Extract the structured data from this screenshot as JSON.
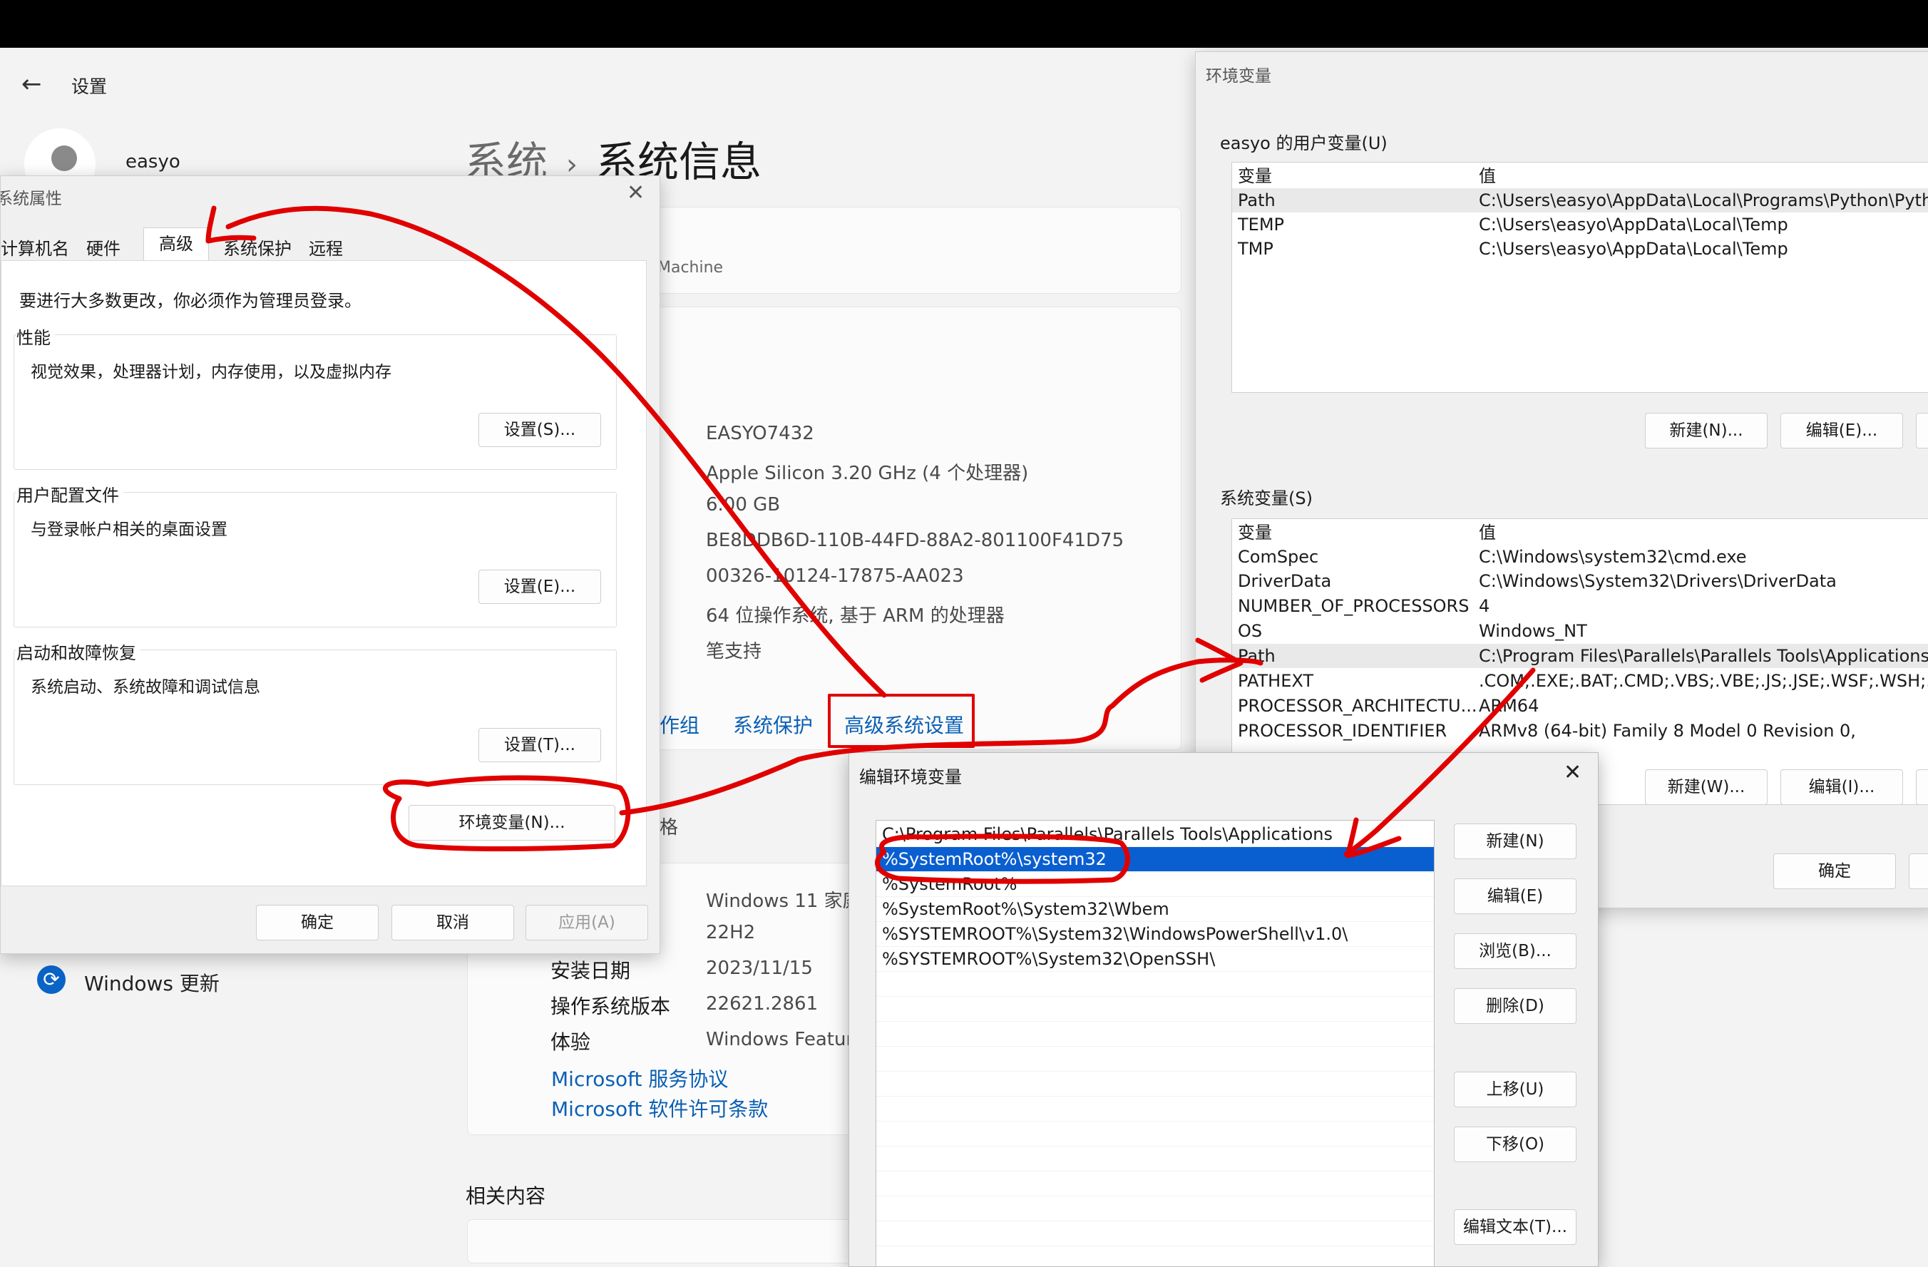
{
  "settings": {
    "app_title": "设置",
    "username": "easyo",
    "breadcrumb_parent": "系统",
    "breadcrumb_sep": "›",
    "page_title": "系统信息",
    "device_subtitle": "Machine",
    "specs": [
      "EASYO7432",
      "Apple Silicon    3.20 GHz  (4 个处理器)",
      "6.00 GB",
      "BE8DDB6D-110B-44FD-88A2-801100F41D75",
      "00326-10124-17875-AA023",
      "64 位操作系统, 基于 ARM 的处理器",
      "笔支持"
    ],
    "links": {
      "workgroup": "作组",
      "protection": "系统保护",
      "advanced": "高级系统设置"
    },
    "related_label": "格",
    "win_specs": [
      {
        "label": "",
        "value": "Windows 11 家庭"
      },
      {
        "label": "",
        "value": "22H2"
      },
      {
        "label": "安装日期",
        "value": "2023/11/15"
      },
      {
        "label": "操作系统版本",
        "value": "22621.2861"
      },
      {
        "label": "体验",
        "value": "Windows Featur"
      }
    ],
    "ms_links": [
      "Microsoft 服务协议",
      "Microsoft 软件许可条款"
    ],
    "related_content": "相关内容",
    "windows_update": "Windows 更新"
  },
  "sysprop": {
    "title": "系统属性",
    "tabs": [
      "计算机名",
      "硬件",
      "高级",
      "系统保护",
      "远程"
    ],
    "admin_note": "要进行大多数更改，你必须作为管理员登录。",
    "groups": [
      {
        "title": "性能",
        "desc": "视觉效果，处理器计划，内存使用，以及虚拟内存",
        "button": "设置(S)..."
      },
      {
        "title": "用户配置文件",
        "desc": "与登录帐户相关的桌面设置",
        "button": "设置(E)..."
      },
      {
        "title": "启动和故障恢复",
        "desc": "系统启动、系统故障和调试信息",
        "button": "设置(T)..."
      }
    ],
    "env_button": "环境变量(N)...",
    "ok": "确定",
    "cancel": "取消",
    "apply": "应用(A)"
  },
  "envvars": {
    "title": "环境变量",
    "user_section": "easyo 的用户变量(U)",
    "col_var": "变量",
    "col_val": "值",
    "user_vars": [
      {
        "name": "Path",
        "value": "C:\\Users\\easyo\\AppData\\Local\\Programs\\Python\\Pytho"
      },
      {
        "name": "TEMP",
        "value": "C:\\Users\\easyo\\AppData\\Local\\Temp"
      },
      {
        "name": "TMP",
        "value": "C:\\Users\\easyo\\AppData\\Local\\Temp"
      }
    ],
    "user_new": "新建(N)...",
    "user_edit": "编辑(E)...",
    "sys_section": "系统变量(S)",
    "sys_vars": [
      {
        "name": "ComSpec",
        "value": "C:\\Windows\\system32\\cmd.exe"
      },
      {
        "name": "DriverData",
        "value": "C:\\Windows\\System32\\Drivers\\DriverData"
      },
      {
        "name": "NUMBER_OF_PROCESSORS",
        "value": "4"
      },
      {
        "name": "OS",
        "value": "Windows_NT"
      },
      {
        "name": "Path",
        "value": "C:\\Program Files\\Parallels\\Parallels Tools\\Applications;C"
      },
      {
        "name": "PATHEXT",
        "value": ".COM;.EXE;.BAT;.CMD;.VBS;.VBE;.JS;.JSE;.WSF;.WSH;.MSC"
      },
      {
        "name": "PROCESSOR_ARCHITECTU...",
        "value": "ARM64"
      },
      {
        "name": "PROCESSOR_IDENTIFIER",
        "value": "ARMv8 (64-bit) Family 8 Model 0 Revision   0,"
      }
    ],
    "sys_new": "新建(W)...",
    "sys_edit": "编辑(I)...",
    "ok": "确定"
  },
  "editenv": {
    "title": "编辑环境变量",
    "entries": [
      "C:\\Program Files\\Parallels\\Parallels Tools\\Applications",
      "%SystemRoot%\\system32",
      "%SystemRoot%",
      "%SystemRoot%\\System32\\Wbem",
      "%SYSTEMROOT%\\System32\\WindowsPowerShell\\v1.0\\",
      "%SYSTEMROOT%\\System32\\OpenSSH\\"
    ],
    "buttons": {
      "new": "新建(N)",
      "edit": "编辑(E)",
      "browse": "浏览(B)...",
      "delete": "删除(D)",
      "up": "上移(U)",
      "down": "下移(O)",
      "edit_text": "编辑文本(T)..."
    }
  },
  "colors": {
    "accent": "#0a5fb4",
    "selection": "#0a5fd0",
    "annotation": "#e00000"
  },
  "icons": {
    "back": "back-arrow-icon",
    "close": "close-icon",
    "update": "windows-update-icon"
  }
}
